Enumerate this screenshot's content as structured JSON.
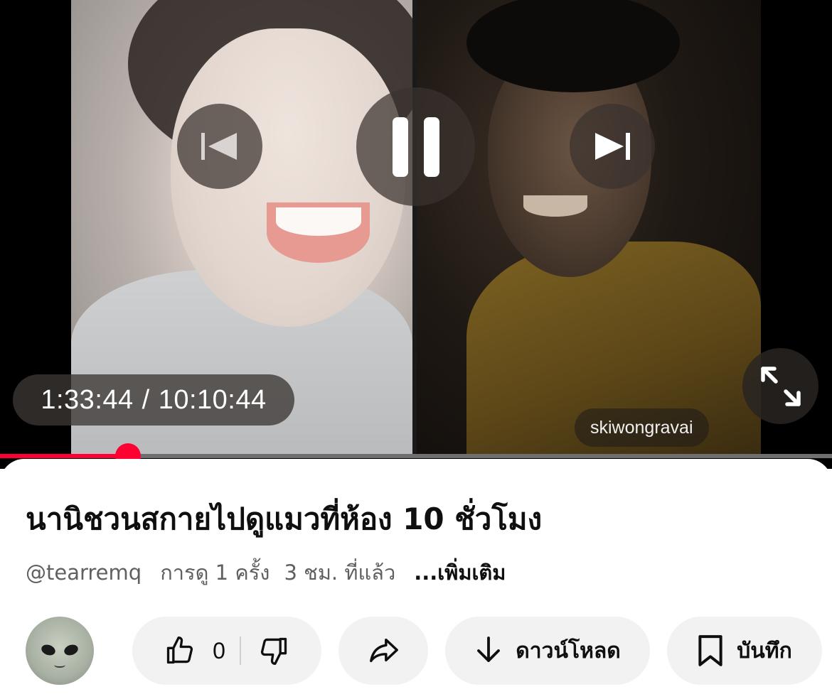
{
  "video": {
    "time_current": "1:33:44",
    "time_separator": "/",
    "time_total": "10:10:44",
    "watermark": "skiwongravai",
    "progress": 0.154,
    "accent_color": "#ff0033",
    "controls": {
      "prev_icon": "skip-previous-icon",
      "pause_icon": "pause-icon",
      "next_icon": "skip-next-icon",
      "fullscreen_icon": "fullscreen-icon"
    }
  },
  "info": {
    "title": "นานิชวนสกายไปดูแมวที่ห้อง 10 ชั่วโมง",
    "channel_handle": "@tearremq",
    "views": "การดู 1 ครั้ง",
    "age": "3 ชม. ที่แล้ว",
    "more": "...เพิ่มเติม"
  },
  "actions": {
    "like_count": "0",
    "download_label": "ดาวน์โหลด",
    "save_label": "บันทึก",
    "icons": [
      "like-icon",
      "dislike-icon",
      "share-icon",
      "download-icon",
      "bookmark-icon"
    ]
  }
}
